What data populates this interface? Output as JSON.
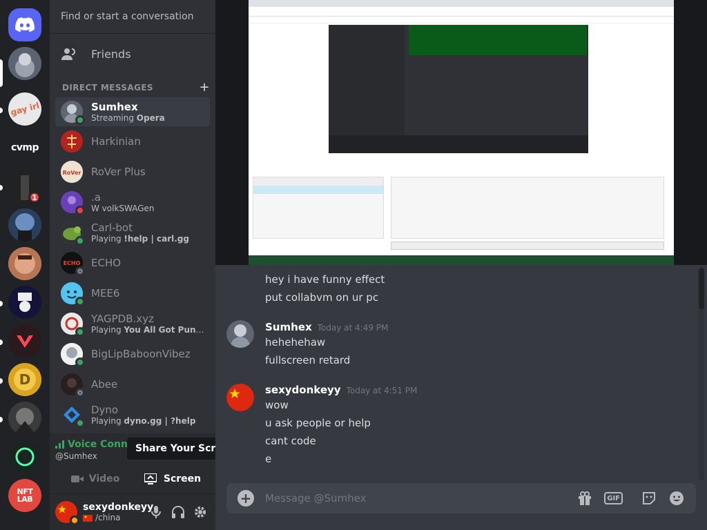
{
  "rail": {
    "servers": [
      {
        "name": "home",
        "icon": "discord-logo-icon"
      },
      {
        "name": "server-avatar-1"
      },
      {
        "name": "gay-irl",
        "label": "gay irl"
      },
      {
        "name": "cvmp",
        "label": "cvmp"
      },
      {
        "name": "server-avatar-dark"
      },
      {
        "name": "server-megamind",
        "badge": "1"
      },
      {
        "name": "server-face"
      },
      {
        "name": "server-hat"
      },
      {
        "name": "server-valorant"
      },
      {
        "name": "server-gold"
      },
      {
        "name": "server-anime"
      },
      {
        "name": "server-c"
      },
      {
        "name": "nft-lab",
        "label": "NFT LAB"
      }
    ]
  },
  "sidebar": {
    "search_placeholder": "Find or start a conversation",
    "friends_label": "Friends",
    "dm_header": "DIRECT MESSAGES",
    "dm_header_add": "+",
    "dms": [
      {
        "name": "Sumhex",
        "sub_prefix": "Streaming ",
        "sub_bold": "Opera",
        "status": "online",
        "active": true
      },
      {
        "name": "Harkinian",
        "sub_prefix": "",
        "sub_bold": "",
        "status": "none"
      },
      {
        "name": "RoVer Plus",
        "sub_prefix": "",
        "sub_bold": "",
        "status": "none"
      },
      {
        "name": ".a",
        "sub_prefix": "W volkSWAGen",
        "sub_bold": "",
        "status": "dnd"
      },
      {
        "name": "Carl-bot",
        "sub_prefix": "Playing ",
        "sub_bold": "!help | carl.gg",
        "status": "online"
      },
      {
        "name": "ECHO",
        "sub_prefix": "",
        "sub_bold": "",
        "status": "offline"
      },
      {
        "name": "MEE6",
        "sub_prefix": "",
        "sub_bold": "",
        "status": "online"
      },
      {
        "name": "YAGPDB.xyz",
        "sub_prefix": "Playing ",
        "sub_bold": "You All Got Punked Du...",
        "status": "online"
      },
      {
        "name": "BigLipBaboonVibez",
        "sub_prefix": "",
        "sub_bold": "",
        "status": "online"
      },
      {
        "name": "Abee",
        "sub_prefix": "",
        "sub_bold": "",
        "status": "offline"
      },
      {
        "name": "Dyno",
        "sub_prefix": "Playing ",
        "sub_bold": "dyno.gg | ?help",
        "status": "online"
      }
    ]
  },
  "voice": {
    "title": "Voice Connect",
    "sub": "@Sumhex",
    "tooltip": "Share Your Screen",
    "video_label": "Video",
    "screen_label": "Screen"
  },
  "user": {
    "name": "sexydonkeyy",
    "tag": "/china"
  },
  "chat": {
    "messages": [
      {
        "lines": [
          "hey i have funny effect",
          "put collabvm on ur pc"
        ]
      },
      {
        "author": "Sumhex",
        "time": "Today at 4:49 PM",
        "lines": [
          "hehehehaw",
          "fullscreen retard"
        ]
      },
      {
        "author": "sexydonkeyy",
        "time": "Today at 4:51 PM",
        "lines": [
          "wow",
          "u ask people or help",
          "cant code",
          "e"
        ]
      }
    ],
    "composer_placeholder": "Message @Sumhex",
    "gif_label": "GIF"
  },
  "colors": {
    "blurple": "#5865f2",
    "online": "#3ba55d",
    "dnd": "#ed4245"
  }
}
